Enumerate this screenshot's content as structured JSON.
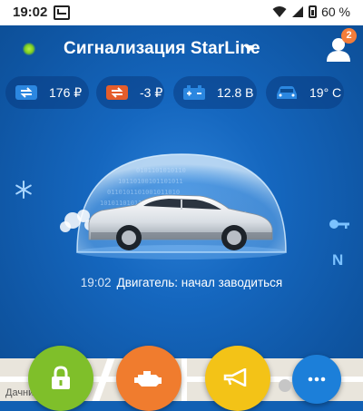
{
  "status_bar": {
    "time": "19:02",
    "battery": "60 %"
  },
  "header": {
    "title": "Сигнализация StarLine",
    "badge_count": "2"
  },
  "info": [
    {
      "icon": "balance-icon",
      "value": "176 ₽",
      "color": "#2b87e0"
    },
    {
      "icon": "balance-negative-icon",
      "value": "-3 ₽",
      "color": "#e55d2b"
    },
    {
      "icon": "battery-icon",
      "value": "12.8 В",
      "color": "#2b87e0"
    },
    {
      "icon": "car-temperature-icon",
      "value": "19° С",
      "color": "#2b87e0"
    }
  ],
  "event": {
    "time": "19:02",
    "text": "Двигатель: начал заводиться"
  },
  "side_indicators": {
    "snow": "snowflake-icon",
    "key": "key-icon",
    "gear": "N"
  },
  "map": {
    "label": "Дачни"
  },
  "actions": [
    {
      "name": "lock",
      "color": "#7fbf2a"
    },
    {
      "name": "engine",
      "color": "#f07c2e"
    },
    {
      "name": "horn",
      "color": "#f3c317"
    },
    {
      "name": "more",
      "color": "#1c7fd9"
    }
  ]
}
